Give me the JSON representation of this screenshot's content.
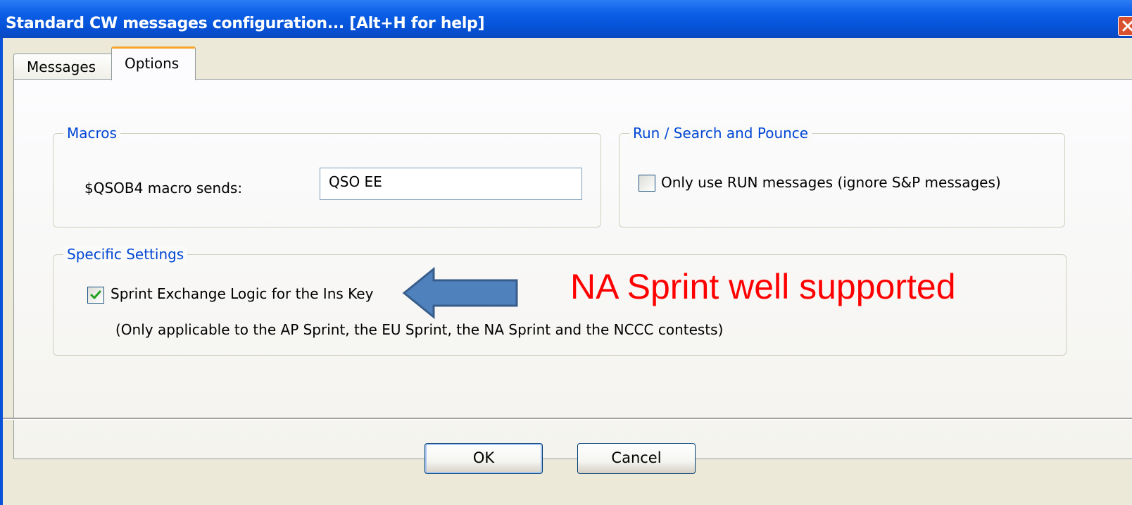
{
  "window": {
    "title": "Standard CW messages configuration... [Alt+H for help]"
  },
  "tabs": [
    {
      "label": "Messages",
      "selected": false
    },
    {
      "label": "Options",
      "selected": true
    }
  ],
  "macros": {
    "group_title": "Macros",
    "qsob4_label": "$QSOB4 macro sends:",
    "qsob4_value": "QSO EE"
  },
  "run_sp": {
    "group_title": "Run / Search and Pounce",
    "only_run_label": "Only use RUN messages (ignore S&P messages)",
    "only_run_checked": false
  },
  "specific": {
    "group_title": "Specific Settings",
    "sprint_label": "Sprint Exchange Logic for the Ins Key",
    "sprint_checked": true,
    "note": "(Only applicable to the AP Sprint, the EU Sprint, the NA Sprint and the NCCC contests)"
  },
  "buttons": {
    "ok": "OK",
    "cancel": "Cancel"
  },
  "annotation": {
    "text": "NA Sprint well supported",
    "color": "#ff0000",
    "arrow_color": "#4f81bd"
  },
  "icons": {
    "close": "close-icon",
    "checkmark": "checkmark-icon",
    "arrow": "left-arrow-icon"
  }
}
